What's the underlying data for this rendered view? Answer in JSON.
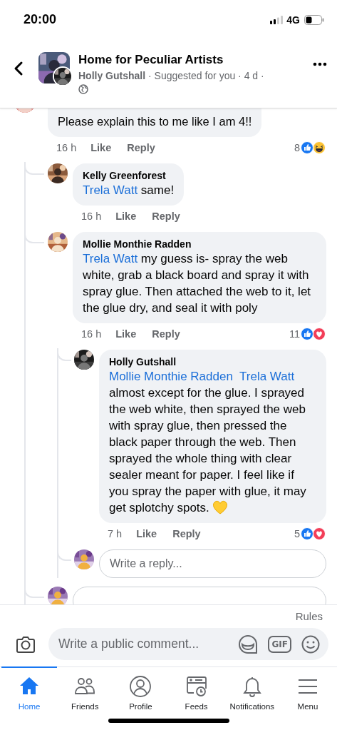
{
  "status_bar": {
    "time": "20:00",
    "network": "4G"
  },
  "header": {
    "group": "Home for Peculiar Artists",
    "author": "Holly Gutshall",
    "meta": "· Suggested for you · 4 d ·"
  },
  "comments": [
    {
      "text": "Please explain this to me like I am 4!!",
      "time": "16 h",
      "like": "Like",
      "reply": "Reply",
      "count": "8",
      "reactions": [
        {
          "kind": "like"
        },
        {
          "kind": "haha"
        }
      ],
      "has_reply_box": true,
      "children": [
        {
          "author": "Kelly Greenforest",
          "mentions": [
            "Trela Watt"
          ],
          "text": "same!",
          "time": "16 h",
          "like": "Like",
          "reply": "Reply"
        },
        {
          "author": "Mollie Monthie Radden",
          "mentions": [
            "Trela Watt"
          ],
          "text": "my guess is- spray the web white, grab a black board and spray it with spray glue. Then attached the web to it, let the glue dry, and seal it with poly",
          "time": "16 h",
          "like": "Like",
          "reply": "Reply",
          "count": "11",
          "reactions": [
            {
              "kind": "like"
            },
            {
              "kind": "love"
            }
          ],
          "has_reply_box": true,
          "reply_placeholder": "Write a reply...",
          "children": [
            {
              "author": "Holly Gutshall",
              "mentions": [
                "Mollie Monthie Radden",
                "Trela Watt"
              ],
              "mentions_on_own_line": true,
              "text": "almost except for the glue. I sprayed the web white, then sprayed the web with spray glue, then pressed the black paper through the web. Then sprayed the whole thing with clear sealer meant for paper. I feel like if you spray the paper with glue, it may get splotchy spots.",
              "has_heart": true,
              "time": "7 h",
              "like": "Like",
              "reply": "Reply",
              "count": "5",
              "reactions": [
                {
                  "kind": "like"
                },
                {
                  "kind": "love"
                }
              ]
            }
          ]
        }
      ]
    }
  ],
  "composer": {
    "rules": "Rules",
    "placeholder": "Write a public comment...",
    "gif_label": "GIF"
  },
  "tabs": [
    {
      "label": "Home",
      "selected": true
    },
    {
      "label": "Friends",
      "selected": false
    },
    {
      "label": "Profile",
      "selected": false
    },
    {
      "label": "Feeds",
      "selected": false
    },
    {
      "label": "Notifications",
      "selected": false
    },
    {
      "label": "Menu",
      "selected": false
    }
  ]
}
